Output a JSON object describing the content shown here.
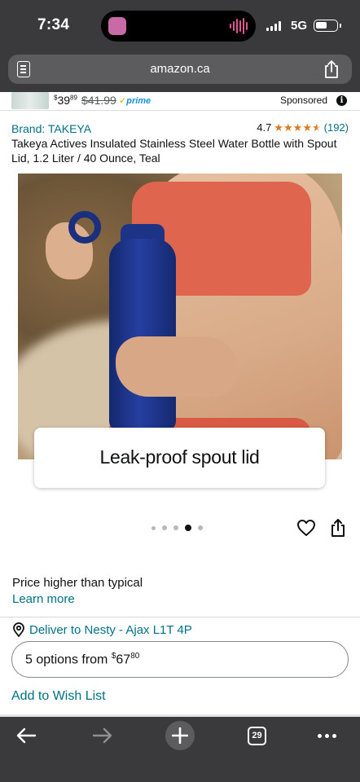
{
  "status": {
    "time": "7:34",
    "network": "5G",
    "battery_level": 0.55
  },
  "browser": {
    "url": "amazon.ca",
    "tab_count": "29"
  },
  "sponsored": {
    "price_whole": "39",
    "price_fraction": "89",
    "currency": "$",
    "list_price": "$41.99",
    "prime_label": "prime",
    "label": "Sponsored",
    "info_glyph": "i"
  },
  "product": {
    "brand": "Brand: TAKEYA",
    "rating": "4.7",
    "stars": 4.5,
    "review_count": "(192)",
    "title": "Takeya Actives Insulated Stainless Steel Water Bottle with Spout Lid, 1.2 Liter / 40 Ounce, Teal",
    "image_caption": "Leak-proof spout lid",
    "carousel_total": 5,
    "carousel_active": 4
  },
  "pricing": {
    "note": "Price higher than typical",
    "learn_more": "Learn more"
  },
  "delivery": {
    "text": "Deliver to Nesty - Ajax L1T 4P"
  },
  "options": {
    "prefix": "5 options from ",
    "currency": "$",
    "price_whole": "67",
    "price_fraction": "80"
  },
  "actions": {
    "wishlist": "Add to Wish List"
  },
  "colors": {
    "link": "#007185",
    "star": "#de7921",
    "chrome": "#3a3a3c"
  }
}
